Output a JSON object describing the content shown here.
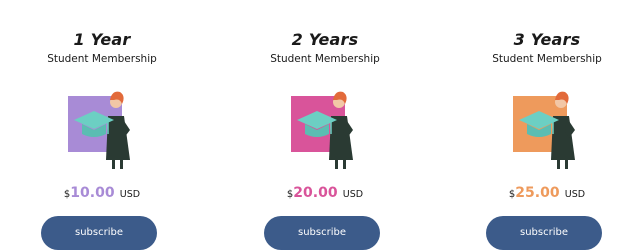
{
  "plans": [
    {
      "title": "1 Year",
      "subtitle": "Student Membership",
      "currency": "$",
      "amount": "10.00",
      "unit": "USD",
      "accent_color": "#a88bd6",
      "button_label": "subscribe",
      "icon": "graduation-cap-icon"
    },
    {
      "title": "2 Years",
      "subtitle": "Student Membership",
      "currency": "$",
      "amount": "20.00",
      "unit": "USD",
      "accent_color": "#d9549a",
      "button_label": "subscribe",
      "icon": "graduation-cap-icon"
    },
    {
      "title": "3 Years",
      "subtitle": "Student Membership",
      "currency": "$",
      "amount": "25.00",
      "unit": "USD",
      "accent_color": "#ee9a5c",
      "button_label": "subscribe",
      "icon": "graduation-cap-icon"
    }
  ],
  "colors": {
    "button": "#3c5b8a",
    "cap": "#6ccfc3",
    "hair": "#e26a3a",
    "dress": "#2a3a33"
  }
}
